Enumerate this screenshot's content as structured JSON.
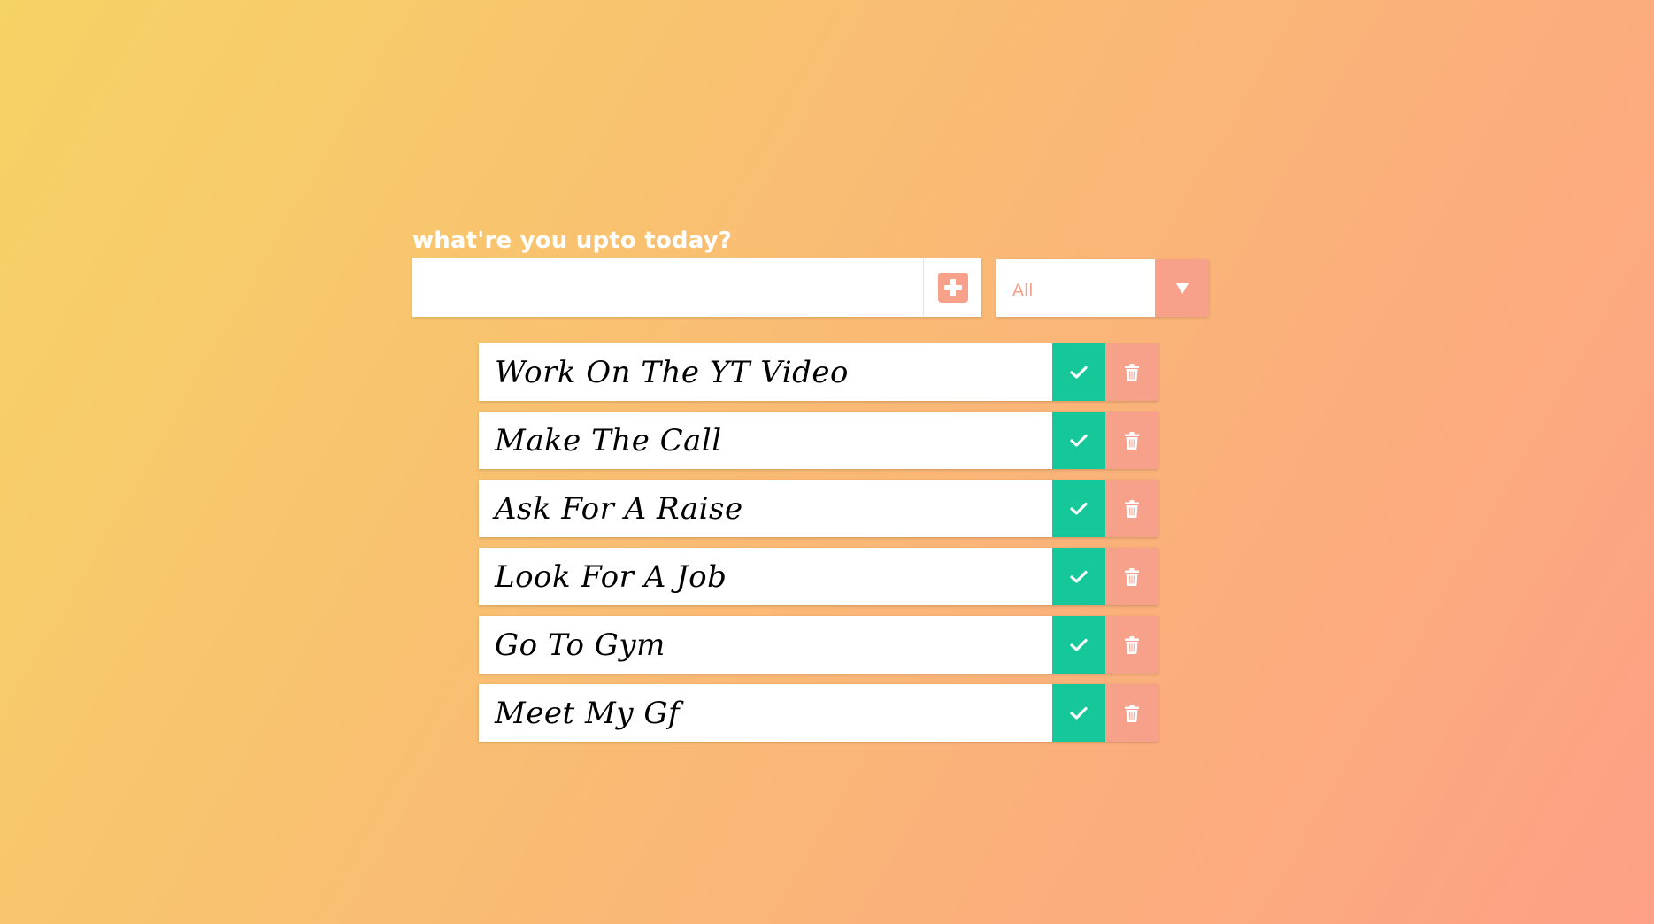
{
  "header": {
    "prompt": "what're you upto today?"
  },
  "todo_input": {
    "value": "",
    "placeholder": ""
  },
  "add_button": {
    "icon": "plus-square-icon"
  },
  "filter": {
    "selected": "All",
    "icon": "caret-down-icon"
  },
  "todos": [
    {
      "text": "Work On The YT Video"
    },
    {
      "text": "Make The Call"
    },
    {
      "text": "Ask For A Raise"
    },
    {
      "text": "Look For A Job"
    },
    {
      "text": "Go To Gym"
    },
    {
      "text": "Meet My Gf"
    }
  ],
  "icons": {
    "complete": "check-icon",
    "delete": "trash-icon"
  },
  "colors": {
    "gradient_start": "#f6d365",
    "gradient_end": "#fda085",
    "accent": "#f7a08a",
    "complete": "#16c79a",
    "text": "#000000"
  }
}
